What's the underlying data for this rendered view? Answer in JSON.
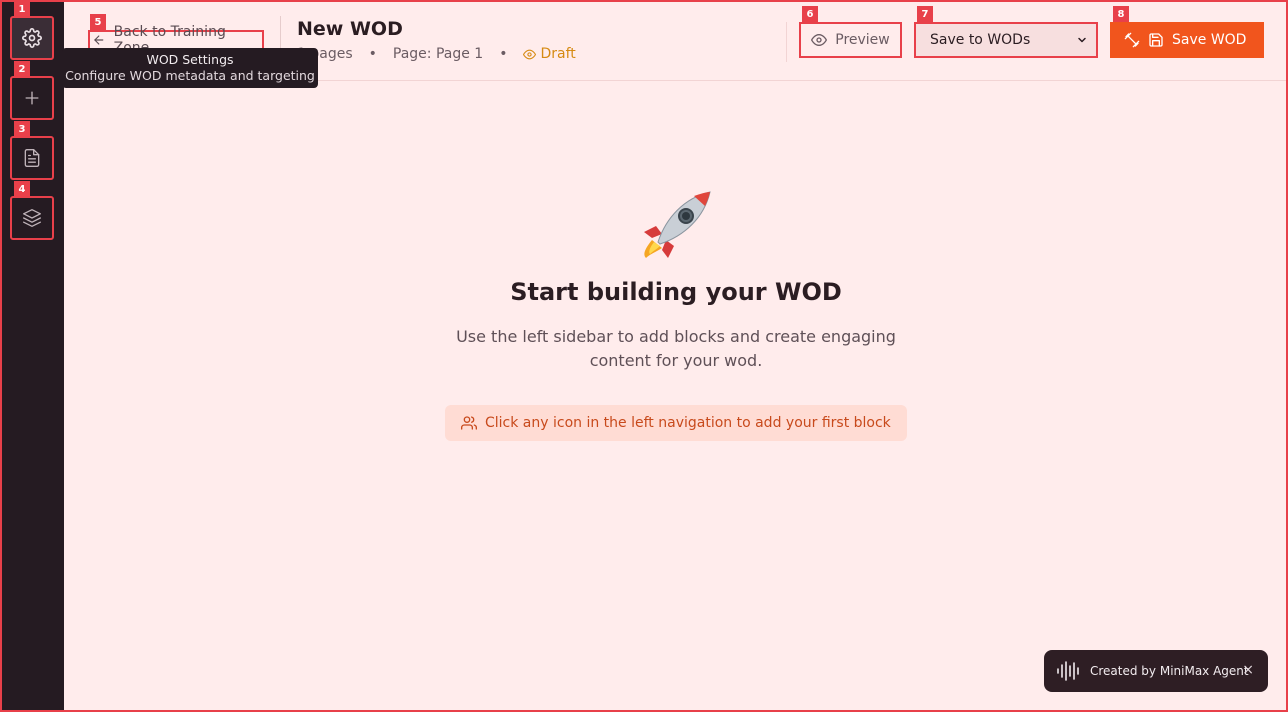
{
  "sidebar": {
    "items": [
      {
        "badge": "1",
        "icon": "gear-icon",
        "tooltip": "WOD Settings"
      },
      {
        "badge": "2",
        "icon": "plus-icon"
      },
      {
        "badge": "3",
        "icon": "document-icon"
      },
      {
        "badge": "4",
        "icon": "layers-icon"
      }
    ]
  },
  "tooltip": {
    "title": "WOD Settings",
    "subtitle": "Configure WOD metadata and targeting"
  },
  "header": {
    "back_badge": "5",
    "back_label": "Back to Training Zone",
    "title": "New WOD",
    "meta_pages": "1 pages",
    "meta_sep": "•",
    "meta_page": "Page: Page 1",
    "meta_status": "Draft",
    "preview_badge": "6",
    "preview_label": "Preview",
    "select_badge": "7",
    "select_value": "Save to WODs",
    "save_badge": "8",
    "save_label": "Save WOD"
  },
  "main": {
    "title": "Start building your WOD",
    "description": "Use the left sidebar to add blocks and create engaging content for your wod.",
    "hint": "Click any icon in the left navigation to add your first block"
  },
  "toast": {
    "label": "Created by MiniMax Agent",
    "close": "×"
  },
  "colors": {
    "accent": "#f1551d",
    "sidebar": "#251b22",
    "background": "#ffecec",
    "annotation": "#e8404a",
    "draft": "#d68a12"
  }
}
